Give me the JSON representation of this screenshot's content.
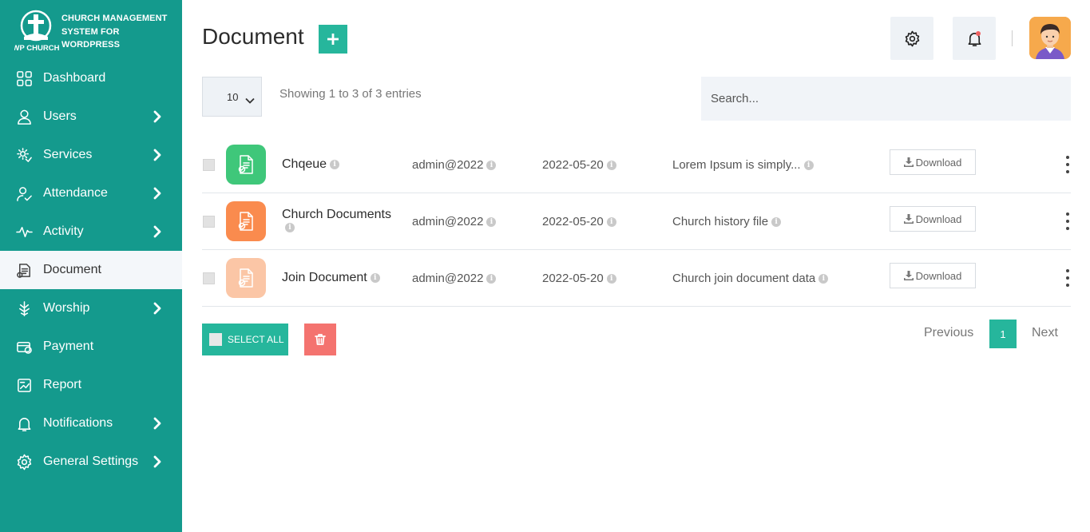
{
  "brand": {
    "logo_text": "WP CHURCH",
    "name": "CHURCH MANAGEMENT SYSTEM FOR WORDPRESS"
  },
  "sidebar": {
    "items": [
      {
        "label": "Dashboard",
        "icon": "dashboard-icon",
        "has_submenu": false
      },
      {
        "label": "Users",
        "icon": "user-icon",
        "has_submenu": true
      },
      {
        "label": "Services",
        "icon": "services-icon",
        "has_submenu": true
      },
      {
        "label": "Attendance",
        "icon": "attendance-icon",
        "has_submenu": true
      },
      {
        "label": "Activity",
        "icon": "activity-icon",
        "has_submenu": true
      },
      {
        "label": "Document",
        "icon": "document-icon",
        "has_submenu": false,
        "active": true
      },
      {
        "label": "Worship",
        "icon": "worship-icon",
        "has_submenu": true
      },
      {
        "label": "Payment",
        "icon": "payment-icon",
        "has_submenu": false
      },
      {
        "label": "Report",
        "icon": "report-icon",
        "has_submenu": false
      },
      {
        "label": "Notifications",
        "icon": "bell-icon",
        "has_submenu": true
      },
      {
        "label": "General Settings",
        "icon": "gear-icon",
        "has_submenu": true
      }
    ]
  },
  "header": {
    "title": "Document",
    "add_icon": "plus-icon",
    "settings_icon": "gear-icon",
    "notifications_icon": "bell-icon"
  },
  "toolbar": {
    "page_size": "10",
    "showing_text": "Showing 1 to 3 of 3 entries",
    "search_placeholder": "Search..."
  },
  "documents": [
    {
      "name": "Chqeue",
      "author": "admin@2022",
      "date": "2022-05-20",
      "description": "Lorem Ipsum is simply...",
      "download_label": "Download",
      "icon_color": "#3fc77a"
    },
    {
      "name": "Church Documents",
      "author": "admin@2022",
      "date": "2022-05-20",
      "description": "Church history file",
      "download_label": "Download",
      "icon_color": "#fa8b4e"
    },
    {
      "name": "Join Document",
      "author": "admin@2022",
      "date": "2022-05-20",
      "description": "Church join document data",
      "download_label": "Download",
      "icon_color": "#fbc6a6"
    }
  ],
  "footer": {
    "select_all_label": "SELECT ALL",
    "delete_icon": "trash-icon",
    "previous_label": "Previous",
    "current_page": "1",
    "next_label": "Next"
  },
  "colors": {
    "sidebar_bg": "#149a8d",
    "accent": "#26b69c",
    "danger": "#f4736f"
  }
}
